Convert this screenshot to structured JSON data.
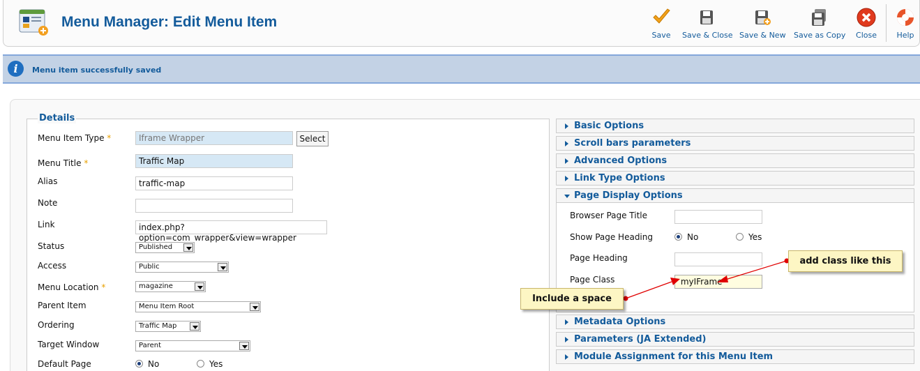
{
  "header": {
    "title": "Menu Manager: Edit Menu Item",
    "toolbar": {
      "save": "Save",
      "save_close": "Save & Close",
      "save_new": "Save & New",
      "save_copy": "Save as Copy",
      "close": "Close",
      "help": "Help"
    }
  },
  "message": "Menu item successfully saved",
  "details": {
    "legend": "Details",
    "menu_item_type_label": "Menu Item Type",
    "menu_item_type_value": "Iframe Wrapper",
    "select_button": "Select",
    "menu_title_label": "Menu Title",
    "menu_title_value": "Traffic Map",
    "alias_label": "Alias",
    "alias_value": "traffic-map",
    "note_label": "Note",
    "note_value": "",
    "link_label": "Link",
    "link_value": "index.php?option=com_wrapper&view=wrapper",
    "status_label": "Status",
    "status_value": "Published",
    "access_label": "Access",
    "access_value": "Public",
    "menu_location_label": "Menu Location",
    "menu_location_value": "magazine",
    "parent_item_label": "Parent Item",
    "parent_item_value": "Menu Item Root",
    "ordering_label": "Ordering",
    "ordering_value": "Traffic Map",
    "target_window_label": "Target Window",
    "target_window_value": "Parent",
    "default_page_label": "Default Page",
    "default_page_no": "No",
    "default_page_yes": "Yes",
    "required_mark": "*"
  },
  "panels": {
    "basic": "Basic Options",
    "scroll": "Scroll bars parameters",
    "advanced": "Advanced Options",
    "link_type": "Link Type Options",
    "page_display": "Page Display Options",
    "metadata": "Metadata Options",
    "parameters": "Parameters (JA Extended)",
    "module_assignment": "Module Assignment for this Menu Item"
  },
  "page_display": {
    "browser_title_label": "Browser Page Title",
    "browser_title_value": "",
    "show_heading_label": "Show Page Heading",
    "show_heading_no": "No",
    "show_heading_yes": "Yes",
    "page_heading_label": "Page Heading",
    "page_heading_value": "",
    "page_class_label": "Page Class",
    "page_class_value": " myIFrame"
  },
  "annotations": {
    "add_class": "add class like this",
    "include_space": "Include a space"
  },
  "colors": {
    "accent": "#135b9b",
    "message_bg": "#c3d2e5",
    "callout_bg": "#fdf6c4",
    "arrow": "#e00000"
  }
}
